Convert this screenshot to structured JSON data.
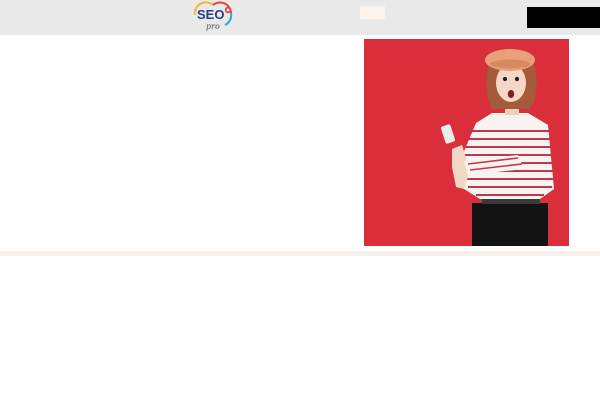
{
  "header": {
    "logo": {
      "text": "SEO",
      "sub_text": "pro",
      "icon": "seo-pro-logo"
    },
    "nav": {
      "pill_label": ""
    },
    "cta": {
      "label": ""
    }
  },
  "hero": {
    "image": {
      "icon": "woman-holding-phone-photo",
      "background_color": "#e0323f"
    }
  },
  "colors": {
    "header_bg": "#e9e9e9",
    "divider_band": "#f6f1ec",
    "cta_bg": "#000000"
  }
}
